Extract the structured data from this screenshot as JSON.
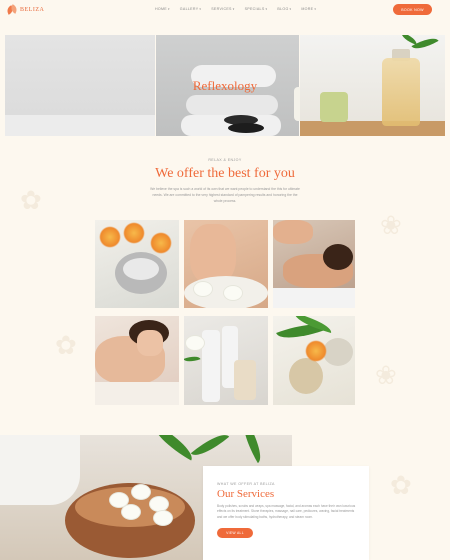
{
  "brand": {
    "name": "BELIZA"
  },
  "nav": {
    "items": [
      {
        "label": "HOME"
      },
      {
        "label": "GALLERY"
      },
      {
        "label": "SERVICES"
      },
      {
        "label": "SPECIALS"
      },
      {
        "label": "BLOG"
      },
      {
        "label": "MORE"
      }
    ],
    "cta_label": "BOOK NOW"
  },
  "hero": {
    "title": "Reflexology"
  },
  "intro": {
    "eyebrow": "RELAX & ENJOY",
    "title": "We offer the best for you",
    "text": "We believe the spa is such a world of its own that we want people to understand the this for ultimate needs. We are committed to the very highest standard of pampering results and honoring the the whole process."
  },
  "services": {
    "eyebrow": "WHAT WE OFFER AT BELIZA",
    "title": "Our Services",
    "text": "Body polishes, scrubs and wraps, spa massage, facial, and aromas each have their own luxurious effects on its treatment. Stone therapies, massage, nail care, pedicures, waxing, facial treatments and we offer body stimulating baths, hydrotherapy, and steam room.",
    "button_label": "VIEW ALL"
  },
  "colors": {
    "accent": "#ef6a3a",
    "background": "#fdf8ef"
  }
}
